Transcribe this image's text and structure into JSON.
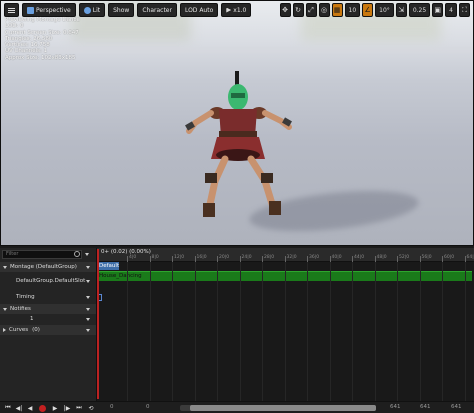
{
  "viewport_toolbar": {
    "perspective": "Perspective",
    "lit": "Lit",
    "show": "Show",
    "character": "Character",
    "lod": "LOD Auto",
    "speed": "x1.0"
  },
  "viewport_right": {
    "grid_snap_value": "10",
    "rotation_snap_value": "10°",
    "scale_snap_value": "0.25",
    "camera_speed": "4"
  },
  "stats": [
    "Previewing Montage Dance",
    "LOD: 0",
    "Current Screen Size: 0.647",
    "Triangles: 26,560",
    "Vertices: 16,758",
    "UV Channels: 1",
    "Approx Size: 102x83x185"
  ],
  "left_panel": {
    "filter_placeholder": "Filter",
    "montage_group": "Montage (DefaultGroup)",
    "slot": "DefaultGroup.DefaultSlot",
    "timing": "Timing",
    "notifies": "Notifies",
    "notify_track": "1",
    "curves": "Curves",
    "curves_count": "(0)"
  },
  "timeline": {
    "time_readout": "0+ (0.02) (0.00%)",
    "section_label": "Default",
    "montage_clip": "House_Dancing",
    "ruler_labels": [
      "4|0",
      "8|0",
      "12|0",
      "16|0",
      "20|0",
      "24|0",
      "28|0",
      "32|0",
      "36|0",
      "40|0",
      "44|0",
      "48|0",
      "52|0",
      "56|0",
      "60|0",
      "64|0"
    ]
  },
  "transport": {
    "start_frame": "0",
    "start_frame_2": "0",
    "end_frame": "641",
    "end_frame_2": "641",
    "end_frame_3": "641"
  },
  "colors": {
    "montage_green": "#1a7a1a",
    "section_blue": "#3e6ea8",
    "playhead_red": "#b22222",
    "snap_orange": "#c9780f"
  }
}
